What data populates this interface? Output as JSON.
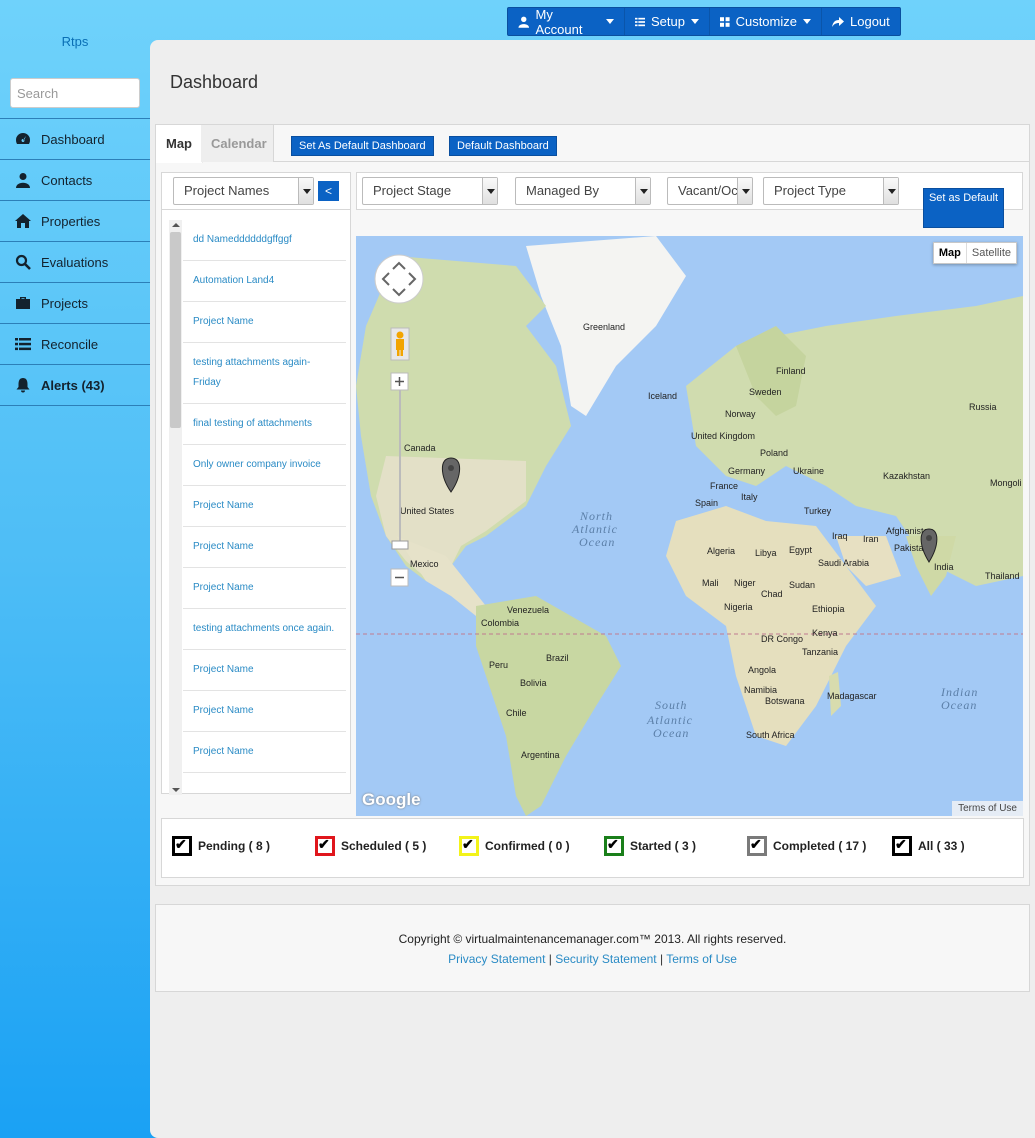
{
  "topnav": {
    "items": [
      {
        "label": "My Account",
        "icon": "user-icon",
        "caret": true
      },
      {
        "label": "Setup",
        "icon": "list-icon",
        "caret": true
      },
      {
        "label": "Customize",
        "icon": "grid-icon",
        "caret": true
      },
      {
        "label": "Logout",
        "icon": "share-icon",
        "caret": false
      }
    ]
  },
  "sidebar": {
    "brand": "Rtps",
    "search_placeholder": "Search",
    "items": [
      {
        "label": "Dashboard",
        "icon": "dashboard-icon"
      },
      {
        "label": "Contacts",
        "icon": "user-icon"
      },
      {
        "label": "Properties",
        "icon": "home-icon"
      },
      {
        "label": "Evaluations",
        "icon": "search-icon"
      },
      {
        "label": "Projects",
        "icon": "briefcase-icon"
      },
      {
        "label": "Reconcile",
        "icon": "list-icon"
      },
      {
        "label": "Alerts (43)",
        "icon": "bell-icon"
      }
    ]
  },
  "page": {
    "title": "Dashboard"
  },
  "tabs": {
    "map": "Map",
    "calendar": "Calendar"
  },
  "buttons": {
    "set_as_default_dashboard": "Set As Default Dashboard",
    "default_dashboard": "Default Dashboard",
    "set_as_default": "Set as Default",
    "collapse": "<"
  },
  "project_list": {
    "select": "Project Names",
    "items": [
      "dd Nameddddddgffggf",
      "Automation Land4",
      "Project Name",
      "testing attachments again-Friday",
      "final testing of attachments",
      "Only owner company invoice",
      "Project Name",
      "Project Name",
      "Project Name",
      "testing attachments once again.",
      "Project Name",
      "Project Name",
      "Project Name"
    ]
  },
  "filters": {
    "project_stage": "Project Stage",
    "managed_by": "Managed By",
    "vacant": "Vacant/Oc",
    "project_type": "Project Type"
  },
  "map": {
    "type_map": "Map",
    "type_satellite": "Satellite",
    "terms": "Terms of Use",
    "google": "Google",
    "labels": {
      "greenland": "Greenland",
      "finland": "Finland",
      "sweden": "Sweden",
      "norway": "Norway",
      "iceland": "Iceland",
      "russia": "Russia",
      "canada": "Canada",
      "united_kingdom": "United Kingdom",
      "poland": "Poland",
      "ukraine": "Ukraine",
      "germany": "Germany",
      "france": "France",
      "italy": "Italy",
      "spain": "Spain",
      "turkey": "Turkey",
      "kazakhstan": "Kazakhstan",
      "mongolia": "Mongoli",
      "afghanistan": "Afghanistan",
      "pakistan": "Pakistan",
      "iran": "Iran",
      "iraq": "Iraq",
      "india": "India",
      "thailand": "Thailand",
      "saudi_arabia": "Saudi Arabia",
      "egypt": "Egypt",
      "libya": "Libya",
      "algeria": "Algeria",
      "mali": "Mali",
      "niger": "Niger",
      "chad": "Chad",
      "sudan": "Sudan",
      "nigeria": "Nigeria",
      "ethiopia": "Ethiopia",
      "kenya": "Kenya",
      "dr_congo": "DR Congo",
      "tanzania": "Tanzania",
      "angola": "Angola",
      "namibia": "Namibia",
      "botswana": "Botswana",
      "south_africa": "South Africa",
      "madagascar": "Madagascar",
      "united_states": "United States",
      "mexico": "Mexico",
      "venezuela": "Venezuela",
      "colombia": "Colombia",
      "peru": "Peru",
      "brazil": "Brazil",
      "bolivia": "Bolivia",
      "chile": "Chile",
      "argentina": "Argentina",
      "north_atlantic_1": "North",
      "north_atlantic_2": "Atlantic",
      "north_atlantic_3": "Ocean",
      "south_atlantic_1": "South",
      "south_atlantic_2": "Atlantic",
      "south_atlantic_3": "Ocean",
      "indian_1": "Indian",
      "indian_2": "Ocean"
    }
  },
  "legend": [
    {
      "label": "Pending ( 8 )",
      "color": "#000000"
    },
    {
      "label": "Scheduled ( 5 )",
      "color": "#e0161c"
    },
    {
      "label": "Confirmed ( 0 )",
      "color": "#f3f31a"
    },
    {
      "label": "Started ( 3 )",
      "color": "#1a7f1a"
    },
    {
      "label": "Completed ( 17 )",
      "color": "#7a7a7a"
    },
    {
      "label": "All ( 33 )",
      "color": "#000000"
    }
  ],
  "footer": {
    "copyright": "Copyright © virtualmaintenancemanager.com™ 2013. All rights reserved.",
    "privacy": "Privacy Statement",
    "security": "Security Statement",
    "terms": "Terms of Use",
    "sep": "|"
  }
}
